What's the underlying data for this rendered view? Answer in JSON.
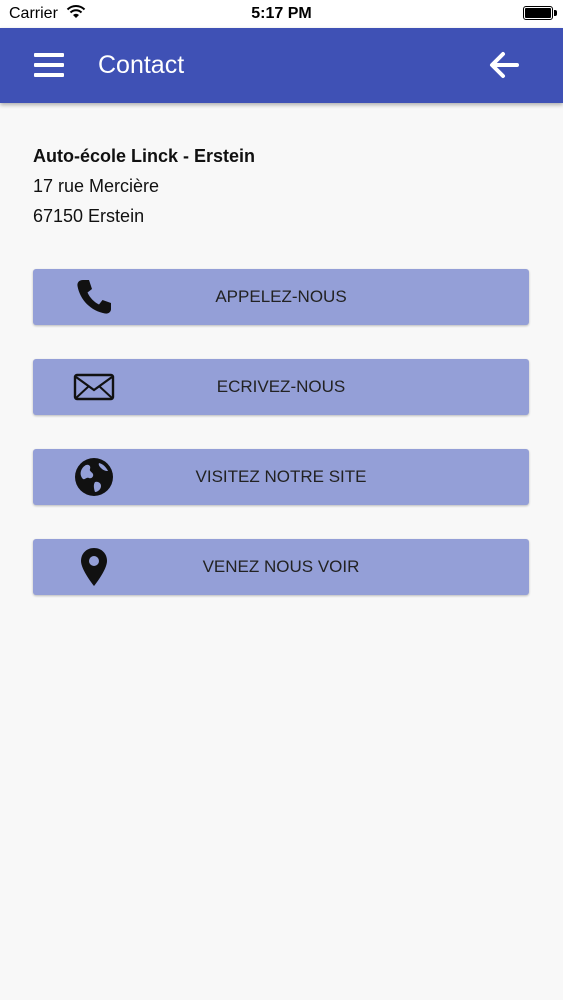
{
  "status_bar": {
    "carrier": "Carrier",
    "time": "5:17 PM"
  },
  "header": {
    "title": "Contact",
    "background_color": "#3f51b5",
    "menu_icon": "hamburger-menu-icon",
    "back_icon": "arrow-left-icon"
  },
  "address": {
    "name": "Auto-école Linck - Erstein",
    "street": "17 rue Mercière",
    "city": "67150 Erstein"
  },
  "actions": {
    "button_color": "#949fd7",
    "call_label": "APPELEZ-NOUS",
    "call_icon": "phone-icon",
    "write_label": "ECRIVEZ-NOUS",
    "write_icon": "envelope-icon",
    "website_label": "VISITEZ NOTRE SITE",
    "website_icon": "globe-icon",
    "visit_label": "VENEZ NOUS VOIR",
    "visit_icon": "map-pin-icon"
  }
}
